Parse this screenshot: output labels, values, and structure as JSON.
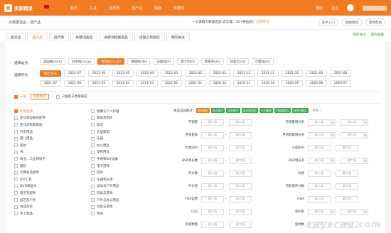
{
  "nav": {
    "logo_mark": "卖",
    "logo_text": "卖家精灵",
    "region": "",
    "menu": [
      "首页",
      "工具",
      "选市场",
      "选产品",
      "购物",
      "数据库"
    ],
    "right": [
      "帮助",
      "社区"
    ]
  },
  "crumb": {
    "path": "大数据选品 › 选产品",
    "notice": "一文详解大数据选品(含实操，26+种选品)",
    "notice_link": "立即学习",
    "buttons": [
      "新手入门",
      "视频教程",
      "使用帮助"
    ]
  },
  "tabs": {
    "items": [
      "查竞品",
      "选产品",
      "选市场",
      "关键词选品",
      "关键词挖掘选品",
      "店铺上新监控",
      "我的关注"
    ],
    "active_index": 1,
    "right": [
      "我的导出",
      "我的收藏"
    ]
  },
  "filters": {
    "site_label": "选择站点",
    "sites": [
      "美国站(com)",
      "日本站(co.jp)",
      "英国站(co.uk)",
      "德国站(de)",
      "法国站(fr)",
      "意大利(it)",
      "西班牙(es)",
      "加拿大(ca)",
      "印度站(in)"
    ],
    "site_selected": 2,
    "time_label": "选择月份",
    "months_row1": [
      "最近30天",
      "2022-07",
      "2022-06",
      "2022-05",
      "2022-04",
      "2022-03",
      "2022-02",
      "2022-01",
      "2021-12",
      "2021-11",
      "2021-10",
      "2021-09",
      "2021-08"
    ],
    "months_row2": [
      "2021-07",
      "2021-06",
      "2021-05",
      "2021-04",
      "2021-03",
      "2021-02",
      "2021-01",
      "2020-12",
      "2020-11",
      "2020-10",
      "2020-09",
      "2020-08",
      "2020-07"
    ],
    "month_selected": 0
  },
  "category_bar": {
    "checkbox_label": "一级",
    "select_btn": "选择类目",
    "option_label": "只搜索子类目按钮"
  },
  "categories_col1": [
    "不限类目",
    "亚马逊设备及配件",
    "亚马逊智能家居",
    "汽车用品",
    "婴儿用品",
    "美妆",
    "书",
    "商业、工业和科学",
    "服装",
    "计算机及配件",
    "DIY工具",
    "DVD和蓝光",
    "电子及配件",
    "园艺及户外",
    "食品杂货",
    "手工制品"
  ],
  "categories_col2": [
    "健康与个人护理",
    "家居及厨房",
    "珠宝",
    "大型家电",
    "乐器",
    "办公用品",
    "宠物用品",
    "手表和DIY设备",
    "电子游戏",
    "软件",
    "乐器和乐谱",
    "运动与户外用品",
    "玩具与游戏",
    "户外与办公用品",
    "玩具与游戏",
    "手表"
  ],
  "filter_panel": {
    "mode_label": "筛选选品模式",
    "tags": [
      "我的模式",
      "新品潜力",
      "适合新手",
      "低价高利润",
      "小众精选",
      "不限排除品",
      "高评分新品"
    ],
    "tag_colors": [
      "#f47a20",
      "#3aa856",
      "#3aa856",
      "#3aa856",
      "#3aa856",
      "#3aa856",
      "#3aa856"
    ],
    "more": "更多 ›",
    "min": "最小值",
    "max": "最大值",
    "rows": [
      {
        "left": "月销量",
        "right": "月销量增长率",
        "unit": "%"
      },
      {
        "left": "月销售额",
        "right": "月销售额增长率",
        "unit": "%"
      },
      {
        "left": "大类BSR",
        "right": "小类BSR",
        "unit": ""
      },
      {
        "left": "BSR增长数",
        "right": "BSR增长率",
        "unit": "%"
      },
      {
        "left": "评分数",
        "right": "价格",
        "unit": ""
      },
      {
        "left": "评分值",
        "right": "月新增评分数",
        "unit": ""
      },
      {
        "left": "FBA运费",
        "right": "Q&A",
        "unit": ""
      },
      {
        "left": "LQS",
        "right": "毛利率",
        "unit": "%"
      },
      {
        "left": "卖家数量",
        "right": "变体数",
        "unit": ""
      }
    ]
  },
  "watermark": "awyerwu.com"
}
